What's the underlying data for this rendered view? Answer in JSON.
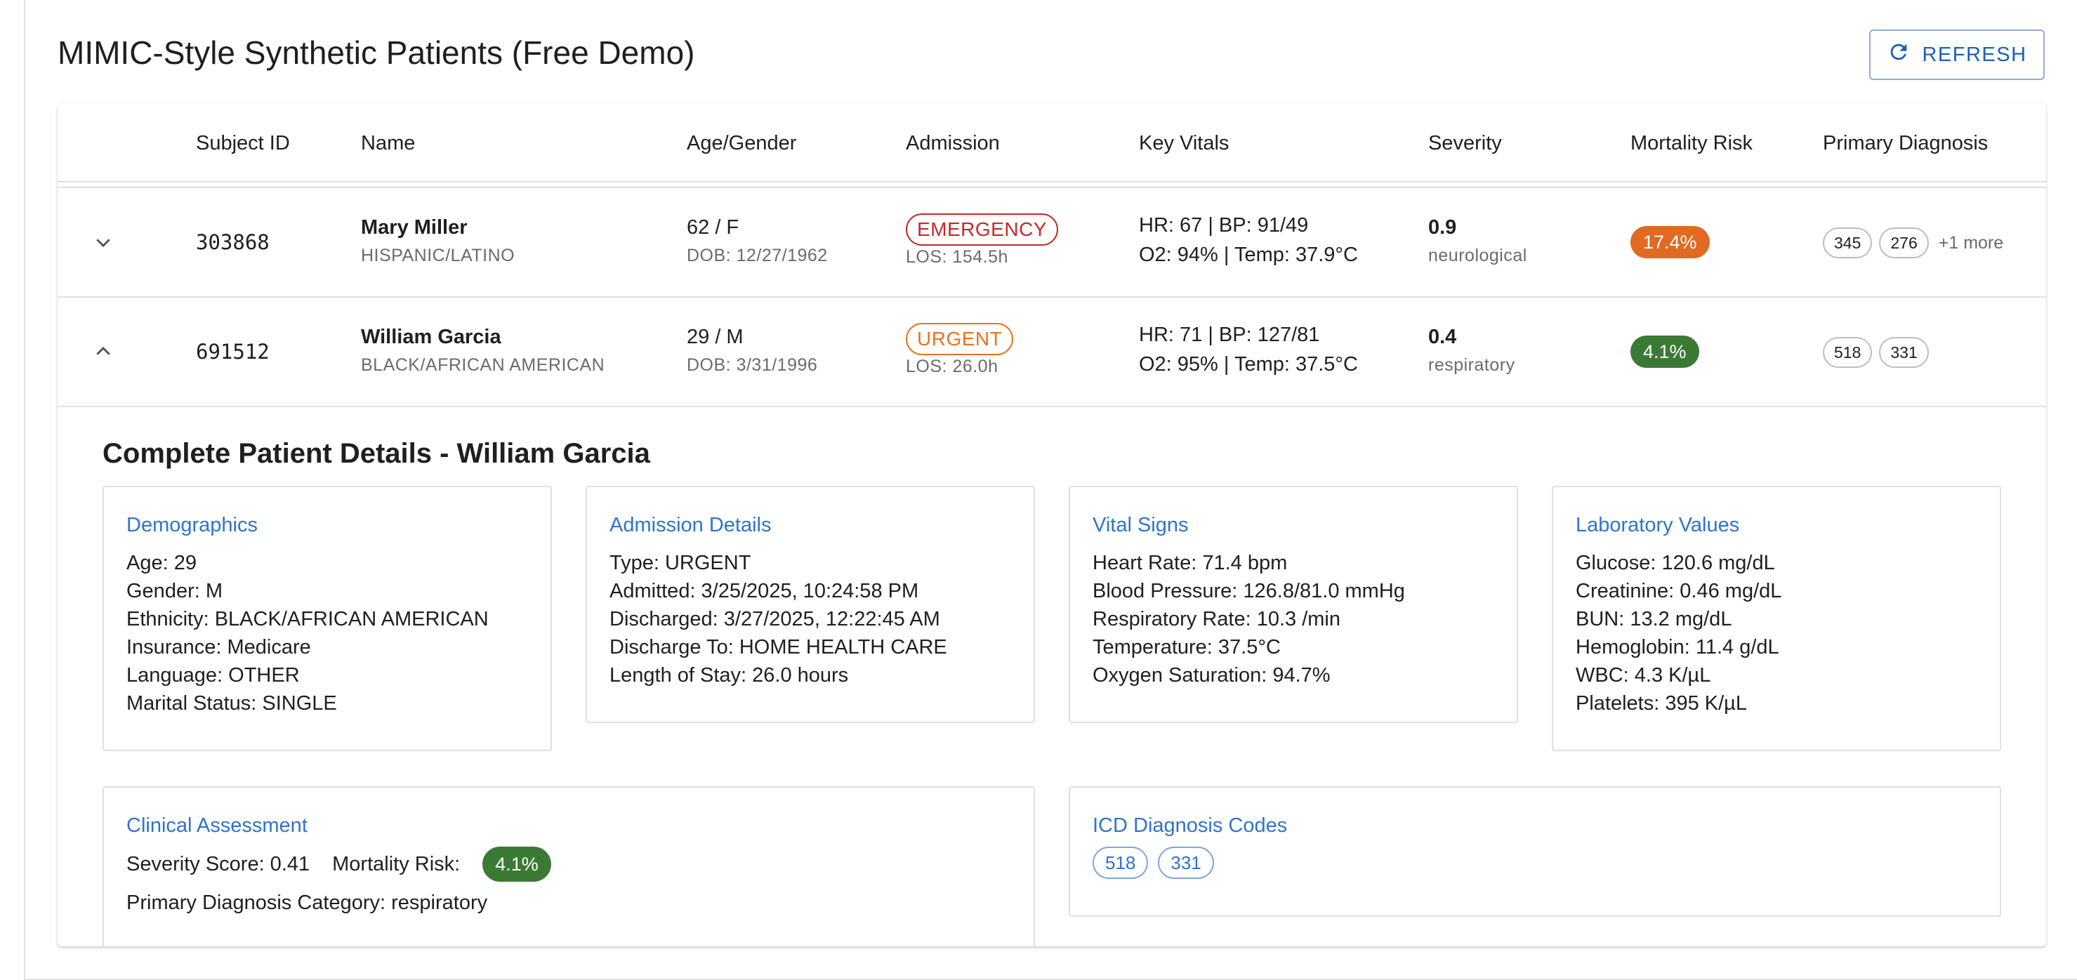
{
  "page": {
    "title": "MIMIC-Style Synthetic Patients (Free Demo)",
    "refresh_label": "REFRESH"
  },
  "table": {
    "headers": [
      "Subject ID",
      "Name",
      "Age/Gender",
      "Admission",
      "Key Vitals",
      "Severity",
      "Mortality Risk",
      "Primary Diagnosis"
    ],
    "rows": [
      {
        "subject_id": "303868",
        "name": "Mary Miller",
        "ethnicity": "HISPANIC/LATINO",
        "age_gender": "62 / F",
        "dob": "DOB: 12/27/1962",
        "admission_type": "EMERGENCY",
        "los": "LOS: 154.5h",
        "vitals_line1": "HR: 67 | BP: 91/49",
        "vitals_line2": "O2: 94% | Temp: 37.9°C",
        "severity": "0.9",
        "category": "neurological",
        "mortality_risk": "17.4%",
        "diagnosis_codes": [
          "345",
          "276"
        ],
        "diagnosis_more": "+1 more",
        "expanded": false
      },
      {
        "subject_id": "691512",
        "name": "William Garcia",
        "ethnicity": "BLACK/AFRICAN AMERICAN",
        "age_gender": "29 / M",
        "dob": "DOB: 3/31/1996",
        "admission_type": "URGENT",
        "los": "LOS: 26.0h",
        "vitals_line1": "HR: 71 | BP: 127/81",
        "vitals_line2": "O2: 95% | Temp: 37.5°C",
        "severity": "0.4",
        "category": "respiratory",
        "mortality_risk": "4.1%",
        "diagnosis_codes": [
          "518",
          "331"
        ],
        "expanded": true
      }
    ]
  },
  "details": {
    "title": "Complete Patient Details - William Garcia",
    "demographics": {
      "title": "Demographics",
      "lines": [
        "Age: 29",
        "Gender: M",
        "Ethnicity: BLACK/AFRICAN AMERICAN",
        "Insurance: Medicare",
        "Language: OTHER",
        "Marital Status: SINGLE"
      ]
    },
    "admission": {
      "title": "Admission Details",
      "lines": [
        "Type: URGENT",
        "Admitted: 3/25/2025, 10:24:58 PM",
        "Discharged: 3/27/2025, 12:22:45 AM",
        "Discharge To: HOME HEALTH CARE",
        "Length of Stay: 26.0 hours"
      ]
    },
    "vitals": {
      "title": "Vital Signs",
      "lines": [
        "Heart Rate: 71.4 bpm",
        "Blood Pressure: 126.8/81.0 mmHg",
        "Respiratory Rate: 10.3 /min",
        "Temperature: 37.5°C",
        "Oxygen Saturation: 94.7%"
      ]
    },
    "labs": {
      "title": "Laboratory Values",
      "lines": [
        "Glucose: 120.6 mg/dL",
        "Creatinine: 0.46 mg/dL",
        "BUN: 13.2 mg/dL",
        "Hemoglobin: 11.4 g/dL",
        "WBC: 4.3 K/µL",
        "Platelets: 395 K/µL"
      ]
    },
    "clinical": {
      "title": "Clinical Assessment",
      "severity_text": "Severity Score: 0.41",
      "mortality_label": "Mortality Risk:",
      "mortality_value": "4.1%",
      "category_text": "Primary Diagnosis Category: respiratory"
    },
    "icd": {
      "title": "ICD Diagnosis Codes",
      "codes": [
        "518",
        "331"
      ]
    }
  },
  "colors": {
    "emergency": "#c62828",
    "urgent": "#e8731f",
    "risk_high": "#e16a22",
    "risk_low": "#3a7a35",
    "accent": "#2f74c8"
  },
  "icons": {
    "refresh": "refresh-icon",
    "expand": "chevron-down-icon",
    "collapse": "chevron-up-icon"
  }
}
